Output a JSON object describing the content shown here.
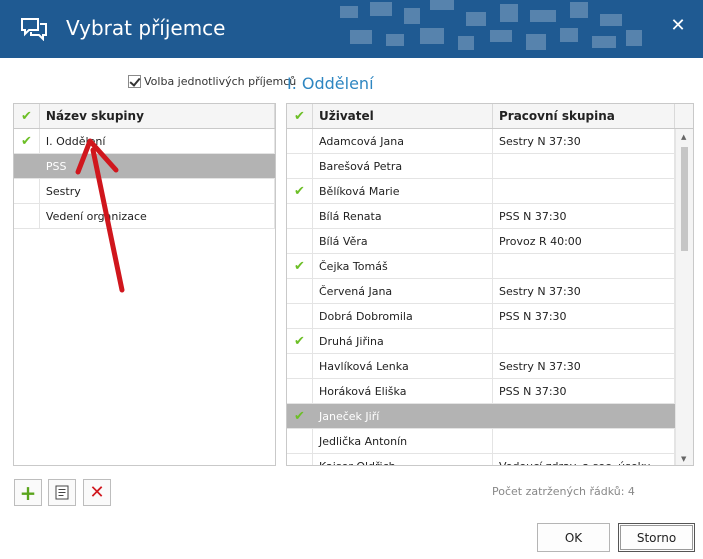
{
  "window": {
    "title": "Vybrat příjemce",
    "close_glyph": "✕"
  },
  "options": {
    "individual_recipients_label": "Volba jednotlivých příjemců",
    "individual_recipients_checked": true
  },
  "selected_group_heading": "I. Oddělení",
  "groups": {
    "header": "Název skupiny",
    "rows": [
      {
        "checked": true,
        "name": "I. Oddělení",
        "selected": false
      },
      {
        "checked": false,
        "name": "PSS",
        "selected": true
      },
      {
        "checked": false,
        "name": "Sestry",
        "selected": false
      },
      {
        "checked": false,
        "name": "Vedení organizace",
        "selected": false
      }
    ]
  },
  "users": {
    "header_user": "Uživatel",
    "header_group": "Pracovní skupina",
    "rows": [
      {
        "checked": false,
        "user": "Adamcová Jana",
        "group": "Sestry N 37:30",
        "selected": false
      },
      {
        "checked": false,
        "user": "Barešová Petra",
        "group": "",
        "selected": false
      },
      {
        "checked": true,
        "user": "Bělíková Marie",
        "group": "",
        "selected": false
      },
      {
        "checked": false,
        "user": "Bílá Renata",
        "group": "PSS N 37:30",
        "selected": false
      },
      {
        "checked": false,
        "user": "Bílá Věra",
        "group": "Provoz R 40:00",
        "selected": false
      },
      {
        "checked": true,
        "user": "Čejka Tomáš",
        "group": "",
        "selected": false
      },
      {
        "checked": false,
        "user": "Červená Jana",
        "group": "Sestry N 37:30",
        "selected": false
      },
      {
        "checked": false,
        "user": "Dobrá Dobromila",
        "group": "PSS N 37:30",
        "selected": false
      },
      {
        "checked": true,
        "user": "Druhá Jiřina",
        "group": "",
        "selected": false
      },
      {
        "checked": false,
        "user": "Havlíková Lenka",
        "group": "Sestry N 37:30",
        "selected": false
      },
      {
        "checked": false,
        "user": "Horáková Eliška",
        "group": "PSS N 37:30",
        "selected": false
      },
      {
        "checked": true,
        "user": "Janeček Jiří",
        "group": "",
        "selected": true
      },
      {
        "checked": false,
        "user": "Jedlička Antonín",
        "group": "",
        "selected": false
      },
      {
        "checked": false,
        "user": "Kaiser Oldřich",
        "group": "Vedoucí zdrav. a soc. úseku",
        "selected": false
      }
    ]
  },
  "toolbar": {
    "add_icon": "plus-icon",
    "edit_icon": "edit-list-icon",
    "delete_icon": "delete-x-icon"
  },
  "status": {
    "checked_rows_text": "Počet zatržených řádků: 4"
  },
  "buttons": {
    "ok": "OK",
    "cancel": "Storno"
  },
  "colors": {
    "titlebar": "#1f5a92",
    "accent_blue": "#2e86c1",
    "check_green": "#6cbf26",
    "selected_row": "#b3b3b3",
    "annotation_arrow": "#d0161d"
  }
}
